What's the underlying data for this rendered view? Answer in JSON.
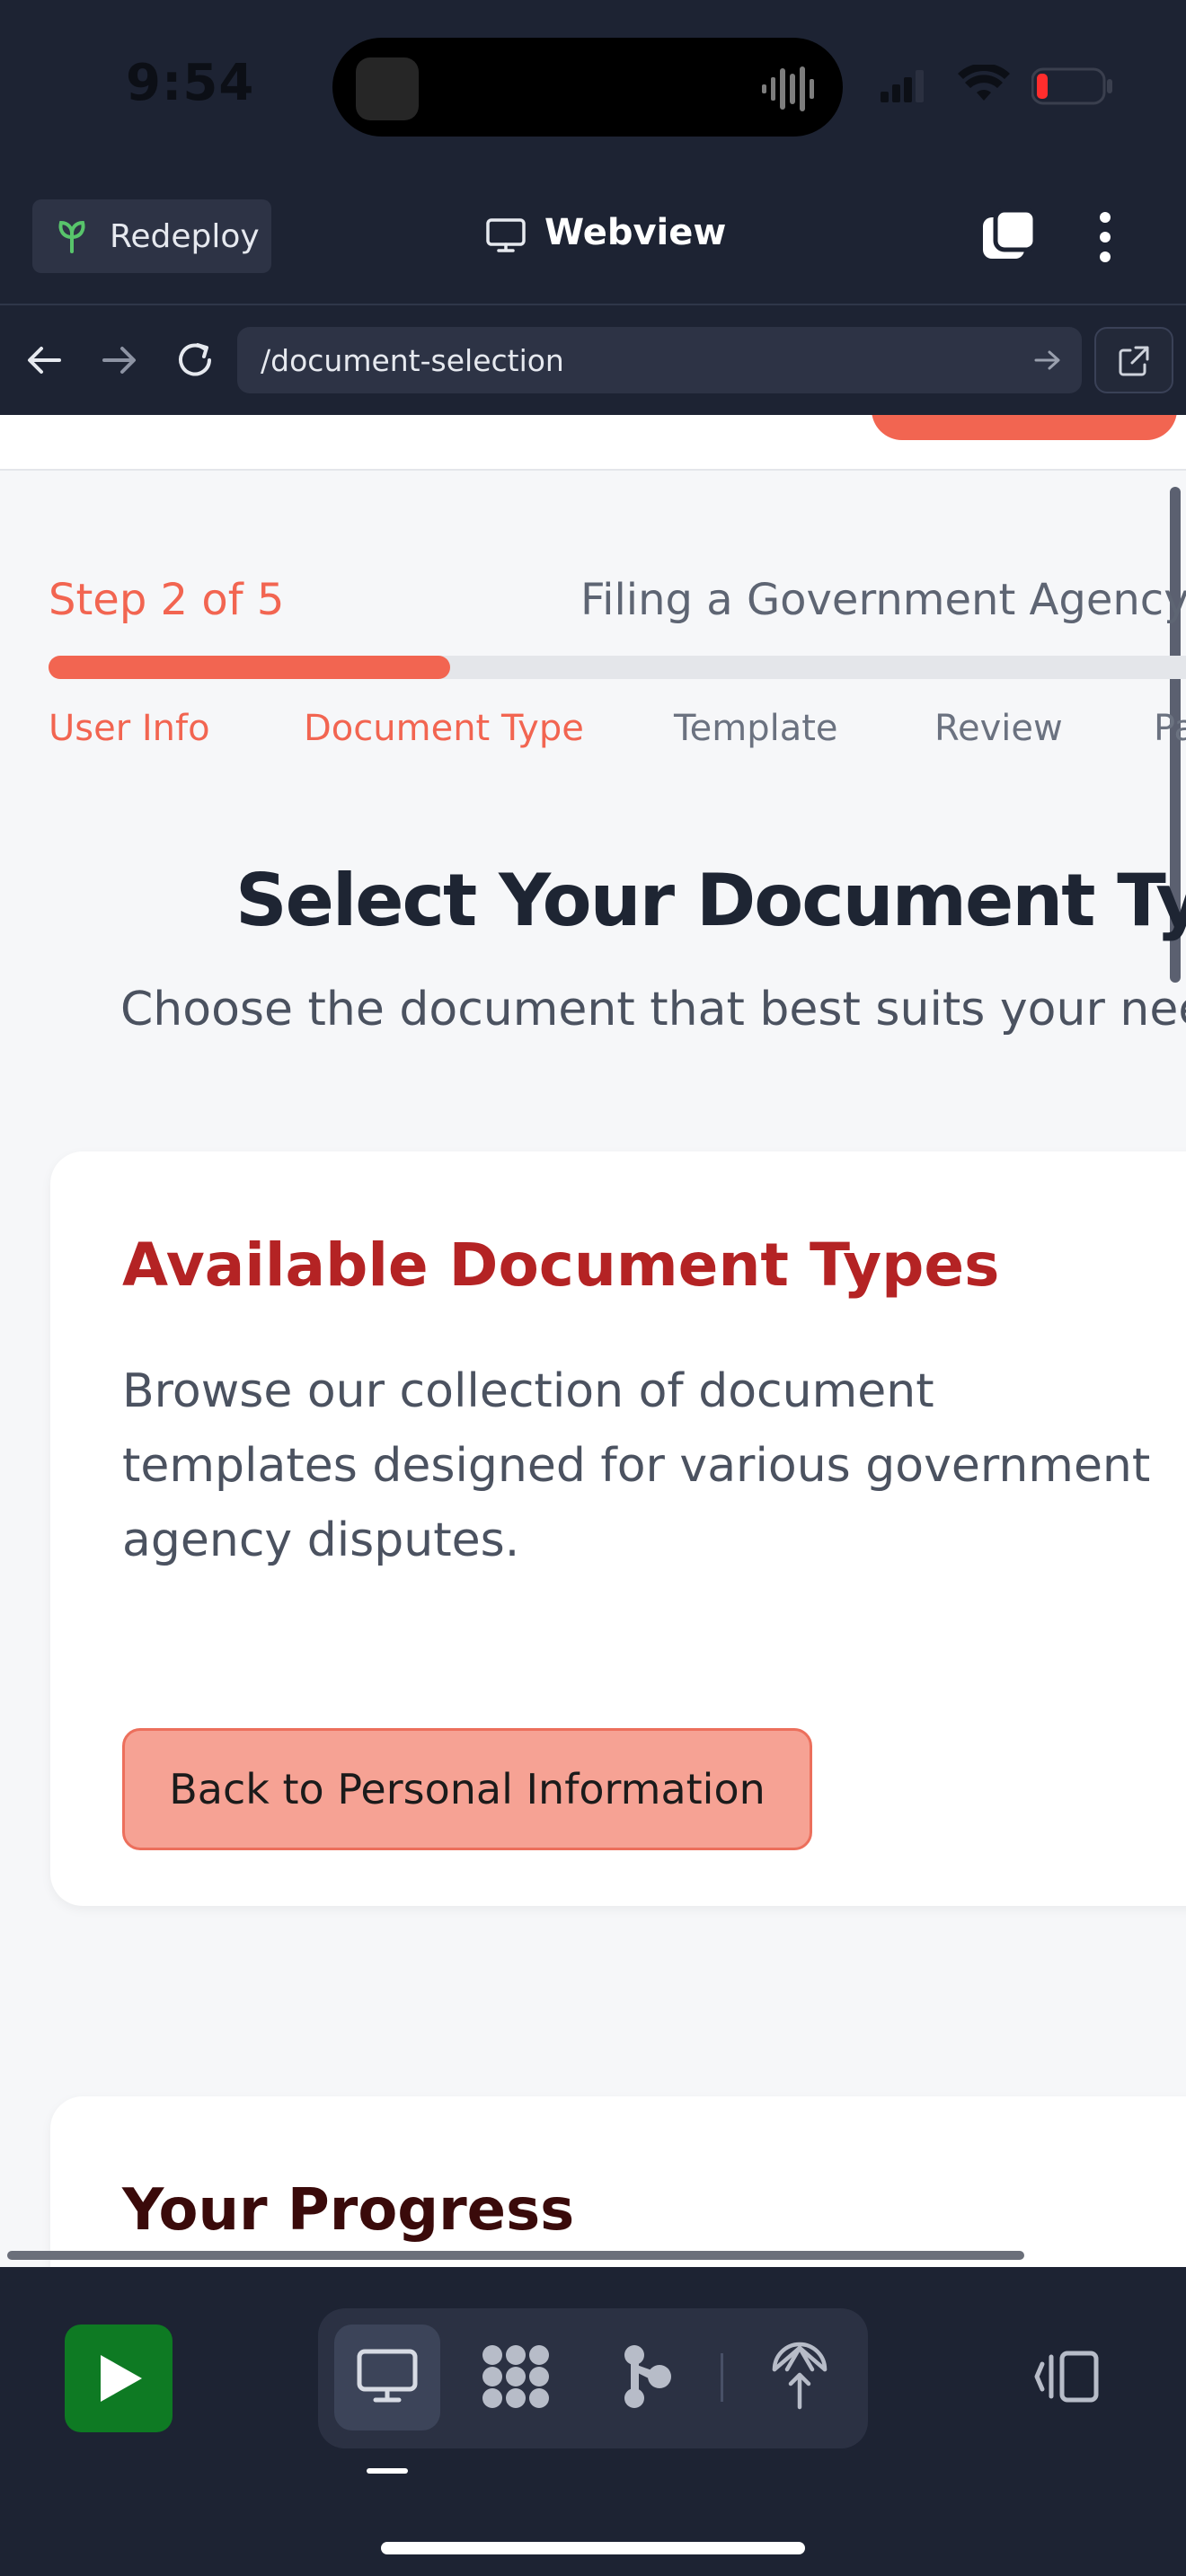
{
  "status_bar": {
    "time": "9:54"
  },
  "app_bar": {
    "redeploy_label": "Redeploy",
    "title": "Webview",
    "icons": [
      "sprout-icon",
      "monitor-icon",
      "tabs-icon",
      "more-vertical-icon"
    ]
  },
  "url_bar": {
    "value": "/document-selection",
    "icons": [
      "back-arrow-icon",
      "forward-arrow-icon",
      "reload-icon",
      "go-arrow-icon",
      "external-link-icon"
    ]
  },
  "page": {
    "step_label": "Step 2 of 5",
    "flow_title": "Filing a Government Agency D",
    "progress_percent": 40,
    "steps": [
      {
        "label": "User Info",
        "state": "active"
      },
      {
        "label": "Document Type",
        "state": "active"
      },
      {
        "label": "Template",
        "state": "inactive"
      },
      {
        "label": "Review",
        "state": "inactive"
      },
      {
        "label": "Pa",
        "state": "inactive"
      }
    ],
    "title": "Select Your Document Type",
    "subtitle": "Choose the document that best suits your nee",
    "card": {
      "title": "Available Document Types",
      "description": "Browse our collection of document templates designed for various government agency disputes.",
      "back_button": "Back to Personal Information"
    },
    "progress_card": {
      "title": "Your Progress"
    }
  },
  "bottom_bar": {
    "icons": [
      "play-icon",
      "desktop-icon",
      "grid-dots-icon",
      "branch-icon",
      "deploy-icon",
      "split-view-icon"
    ]
  },
  "colors": {
    "accent": "#f26551",
    "card_title": "#b42324",
    "dark_bg": "#1d2333",
    "run_green": "#0e7a23"
  }
}
